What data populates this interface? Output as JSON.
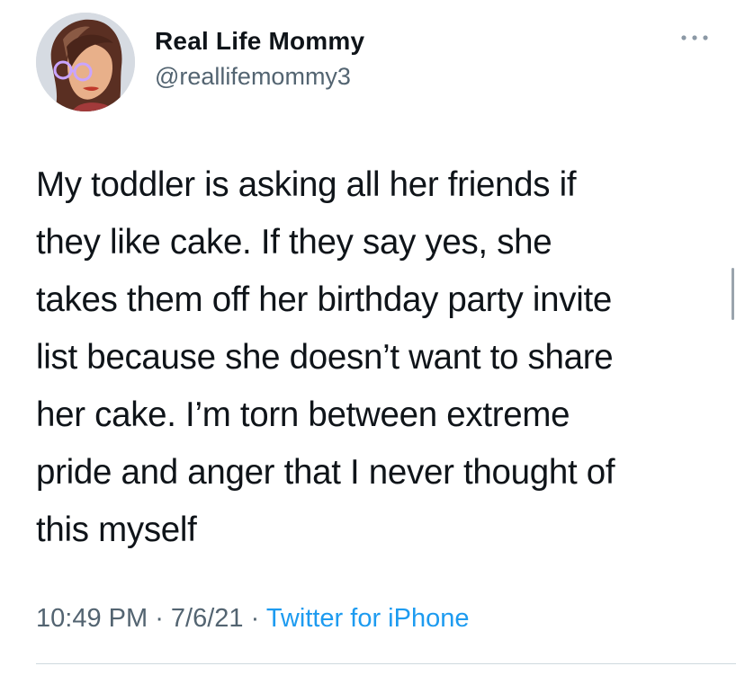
{
  "author": {
    "display_name": "Real Life Mommy",
    "handle": "@reallifemommy3"
  },
  "tweet": {
    "lines": [
      "My toddler is asking all her friends if",
      "they like cake. If they say yes, she",
      "takes them off her birthday party invite",
      "list because she doesn’t want to share",
      "her cake. I’m torn between extreme",
      "pride and anger that I never thought of",
      "this myself"
    ]
  },
  "meta": {
    "time": "10:49 PM",
    "separator": " · ",
    "date": "7/6/21",
    "source": "Twitter for iPhone"
  },
  "icons": {
    "more": "more-horizontal-icon",
    "avatar": "cartoon-woman-with-glasses"
  },
  "colors": {
    "text": "#0f1419",
    "secondary": "#536471",
    "link": "#1d9bf0",
    "divider": "#cfd9de"
  }
}
